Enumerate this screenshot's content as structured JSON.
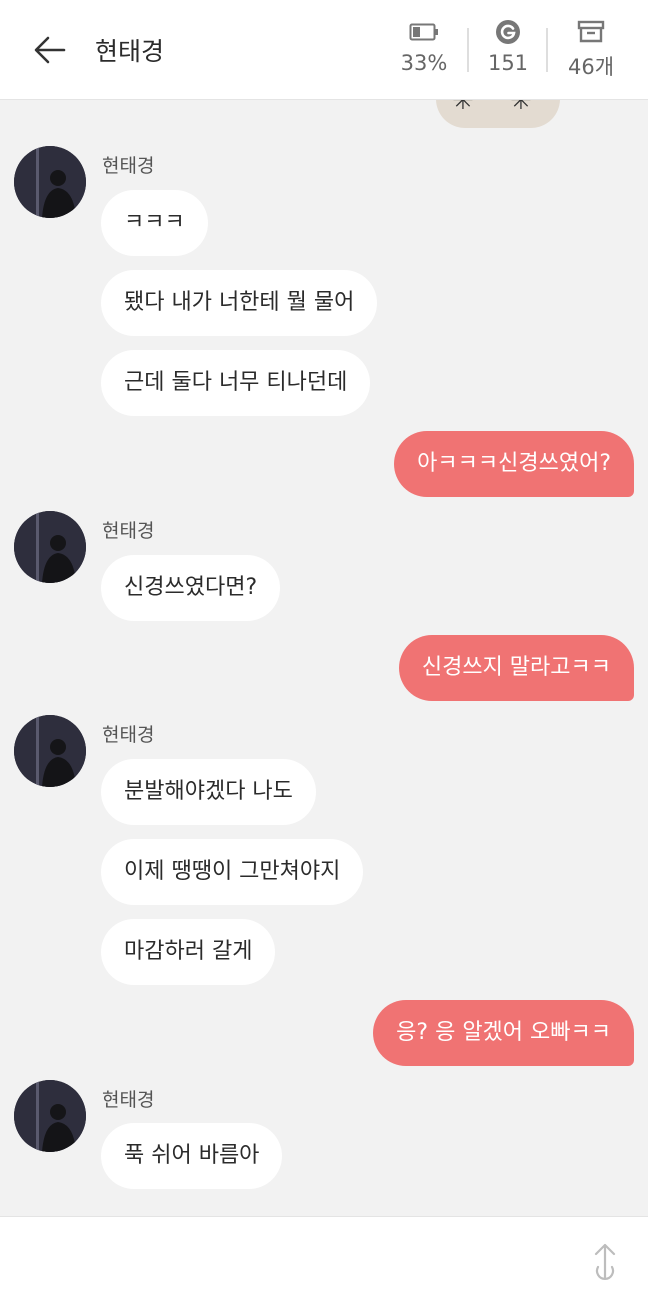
{
  "header": {
    "title": "현태경",
    "battery": "33%",
    "points": "151",
    "archive_count": "46개",
    "icons": {
      "back": "arrow-left-icon",
      "battery": "battery-icon",
      "points": "g-coin-icon",
      "archive": "archive-box-icon"
    }
  },
  "sticker": {
    "left_glyph": "✳",
    "right_glyph": "✳"
  },
  "chat": {
    "messages": [
      {
        "type": "in",
        "sender": "현태경",
        "bubbles": [
          "ㅋㅋㅋ",
          "됐다 내가 너한테 뭘 물어",
          "근데 둘다 너무 티나던데"
        ]
      },
      {
        "type": "out",
        "bubbles": [
          "아ㅋㅋㅋ신경쓰였어?"
        ]
      },
      {
        "type": "in",
        "sender": "현태경",
        "bubbles": [
          "신경쓰였다면?"
        ]
      },
      {
        "type": "out",
        "bubbles": [
          "신경쓰지 말라고ㅋㅋ"
        ]
      },
      {
        "type": "in",
        "sender": "현태경",
        "bubbles": [
          "분발해야겠다 나도",
          "이제 땡땡이 그만쳐야지",
          "마감하러 갈게"
        ]
      },
      {
        "type": "out",
        "bubbles": [
          "응? 응 알겠어 오빠ㅋㅋ"
        ]
      },
      {
        "type": "in",
        "sender": "현태경",
        "bubbles": [
          "푹 쉬어 바름아"
        ]
      }
    ]
  },
  "inputbar": {
    "send_icon": "send-arrow-icon"
  },
  "colors": {
    "outgoing": "#f07373",
    "incoming": "#ffffff",
    "background": "#f2f2f2"
  }
}
